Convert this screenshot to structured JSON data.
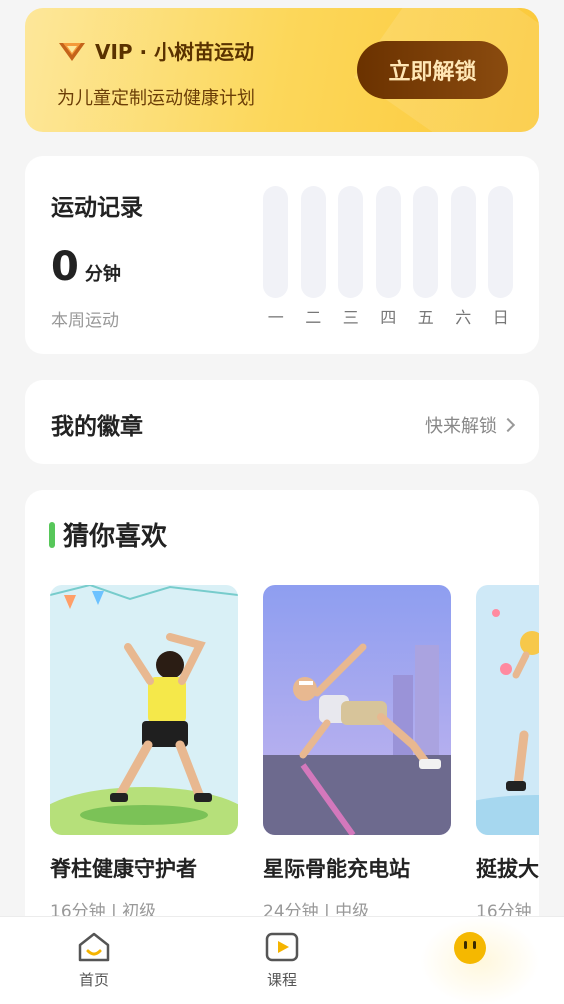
{
  "vip": {
    "title": "VIP · 小树苗运动",
    "subtitle": "为儿童定制运动健康计划",
    "button": "立即解锁",
    "icon": "diamond-v-icon"
  },
  "record": {
    "title": "运动记录",
    "value": "0",
    "unit": "分钟",
    "caption": "本周运动",
    "days": [
      "一",
      "二",
      "三",
      "四",
      "五",
      "六",
      "日"
    ],
    "minutes": [
      0,
      0,
      0,
      0,
      0,
      0,
      0
    ]
  },
  "badges": {
    "title": "我的徽章",
    "link": "快来解锁"
  },
  "guess": {
    "title": "猜你喜欢",
    "courses": [
      {
        "name": "脊柱健康守护者",
        "meta": "16分钟 | 初级"
      },
      {
        "name": "星际骨能充电站",
        "meta": "24分钟 | 中级"
      },
      {
        "name": "挺拔大",
        "meta": "16分钟"
      }
    ]
  },
  "tabs": [
    {
      "label": "首页",
      "icon": "home-icon"
    },
    {
      "label": "课程",
      "icon": "play-icon"
    },
    {
      "label": "",
      "icon": "mascot-face-icon"
    }
  ],
  "colors": {
    "vip_gradient": "#fcd75a",
    "vip_button": "#6b3200",
    "accent_green": "#57c75a",
    "bar_empty": "#f1f2f7"
  }
}
